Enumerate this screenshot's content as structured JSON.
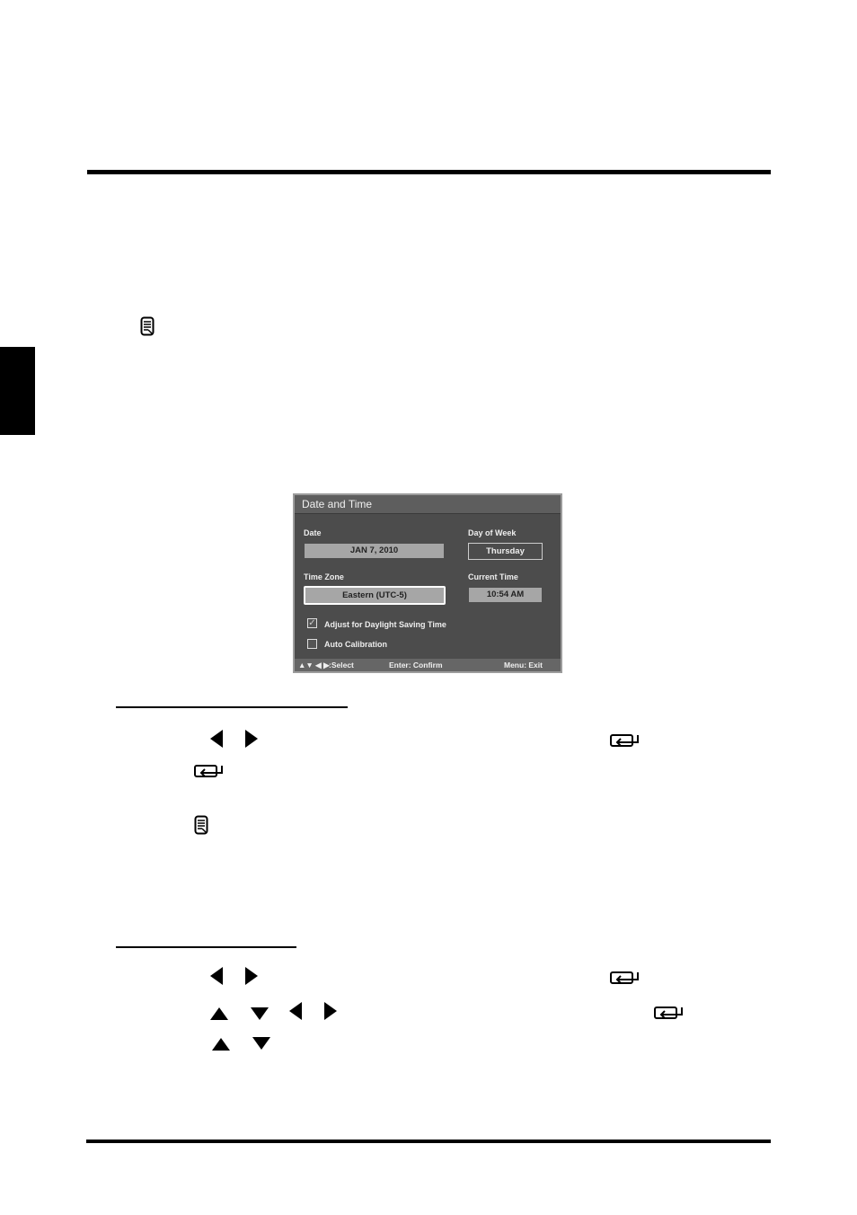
{
  "dialog": {
    "title": "Date and Time",
    "date_label": "Date",
    "date_value": "JAN 7, 2010",
    "day_label": "Day of Week",
    "day_value": "Thursday",
    "timezone_label": "Time Zone",
    "timezone_value": "Eastern (UTC-5)",
    "time_label": "Current Time",
    "time_value": "10:54 AM",
    "dst_label": "Adjust for Daylight Saving Time",
    "dst_checked": true,
    "auto_label": "Auto Calibration",
    "auto_checked": false,
    "footer_select": ":Select",
    "footer_confirm": "Enter: Confirm",
    "footer_exit": "Menu: Exit"
  },
  "icons": [
    "note-icon",
    "left-arrow-icon",
    "right-arrow-icon",
    "up-arrow-icon",
    "down-arrow-icon",
    "enter-icon"
  ]
}
